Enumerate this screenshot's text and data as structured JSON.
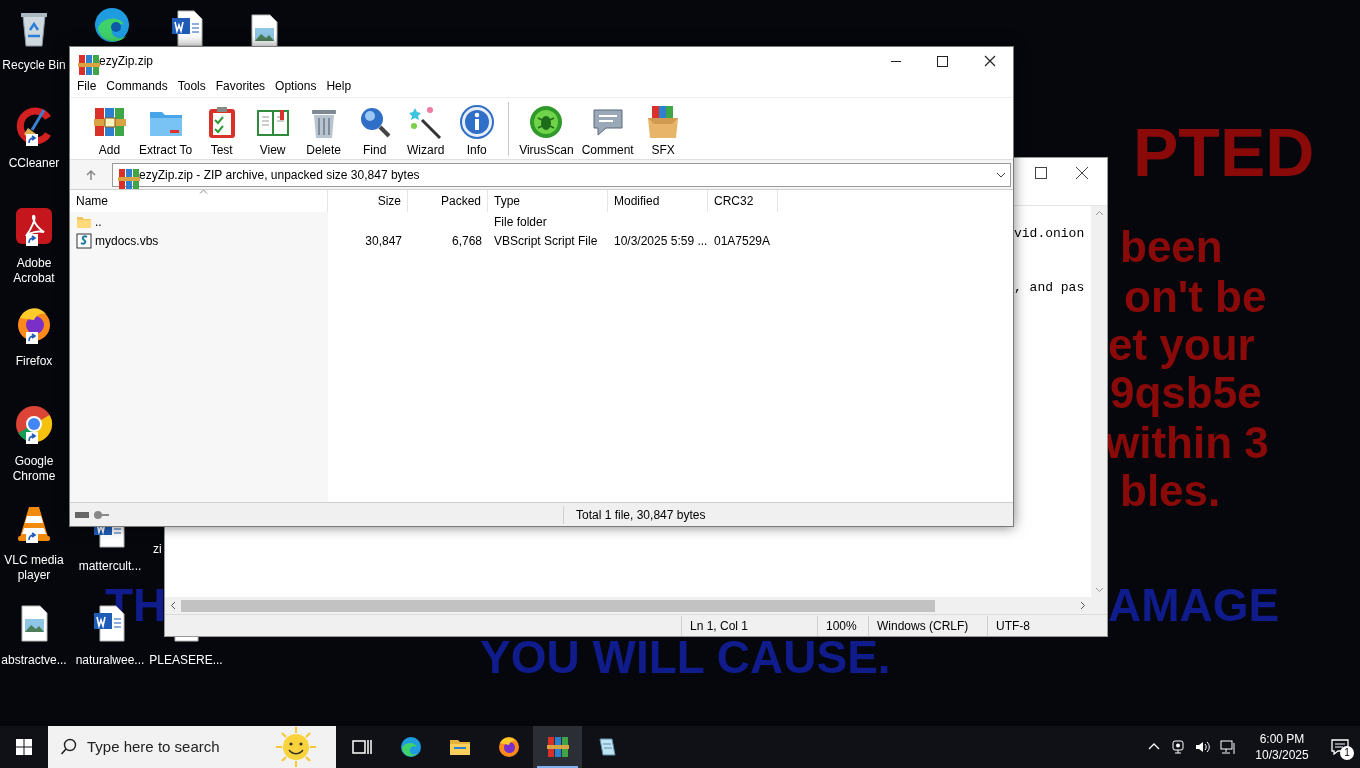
{
  "wallpaper_text": [
    {
      "text": "PTED",
      "color": "#8a0a0a"
    },
    {
      "text": "been",
      "color": "#8a0a0a"
    },
    {
      "text": "on't be",
      "color": "#8a0a0a"
    },
    {
      "text": "et your",
      "color": "#8a0a0a"
    },
    {
      "text": "9qsb5e",
      "color": "#8a0a0a"
    },
    {
      "text": "within 3",
      "color": "#8a0a0a"
    },
    {
      "text": "bles.",
      "color": "#8a0a0a"
    },
    {
      "text": "TH",
      "color": "#101c8c"
    },
    {
      "text": "AMAGE",
      "color": "#101c8c"
    },
    {
      "text": "YOU WILL CAUSE.",
      "color": "#101c8c"
    }
  ],
  "desktop_icons": [
    {
      "kind": "recycle",
      "label": "Recycle Bin"
    },
    {
      "kind": "edge"
    },
    {
      "kind": "word"
    },
    {
      "kind": "image"
    },
    {
      "kind": "ccleaner",
      "label": "CCleaner"
    },
    {
      "kind": "acrobat",
      "label": "Adobe Acrobat"
    },
    {
      "kind": "firefox",
      "label": "Firefox"
    },
    {
      "kind": "chrome",
      "label": "Google Chrome"
    },
    {
      "kind": "vlc",
      "label": "VLC media player"
    },
    {
      "kind": "word",
      "label": "mattercult..."
    },
    {
      "label": "zi"
    },
    {
      "kind": "image",
      "label": "abstractve..."
    },
    {
      "kind": "word",
      "label": "naturalwee..."
    },
    {
      "kind": "text",
      "label": "PLEASERE..."
    }
  ],
  "notepad": {
    "lines": [
      "vid.onion",
      ", and pas"
    ],
    "status": [
      "Ln 1, Col 1",
      "100%",
      "Windows (CRLF)",
      "UTF-8"
    ]
  },
  "winrar": {
    "title": "ezyZip.zip",
    "menu": [
      "File",
      "Commands",
      "Tools",
      "Favorites",
      "Options",
      "Help"
    ],
    "toolbar": [
      [
        {
          "kind": "add",
          "label": "Add"
        },
        {
          "kind": "extract",
          "label": "Extract To"
        },
        {
          "kind": "test",
          "label": "Test"
        },
        {
          "kind": "view",
          "label": "View"
        },
        {
          "kind": "delete",
          "label": "Delete"
        },
        {
          "kind": "find",
          "label": "Find"
        },
        {
          "kind": "wizard",
          "label": "Wizard"
        },
        {
          "kind": "info",
          "label": "Info"
        }
      ],
      [
        {
          "kind": "virus",
          "label": "VirusScan"
        },
        {
          "kind": "comment",
          "label": "Comment"
        },
        {
          "kind": "sfx",
          "label": "SFX"
        }
      ]
    ],
    "address": "ezyZip.zip - ZIP archive, unpacked size 30,847 bytes",
    "columns": [
      {
        "label": "Name",
        "sorted": true
      },
      {
        "label": "Size",
        "sorted": false
      },
      {
        "label": "Packed",
        "sorted": false
      },
      {
        "label": "Type",
        "sorted": false
      },
      {
        "label": "Modified",
        "sorted": false
      },
      {
        "label": "CRC32",
        "sorted": false
      }
    ],
    "rows": [
      {
        "kind": "folder",
        "name": "..",
        "type": "File folder"
      },
      {
        "kind": "script",
        "name": "mydocs.vbs",
        "size": "30,847",
        "packed": "6,768",
        "type": "VBScript Script File",
        "modified": "10/3/2025 5:59 ...",
        "crc32": "01A7529A"
      }
    ],
    "status": "Total 1 file, 30,847 bytes"
  },
  "taskbar": {
    "search_placeholder": "Type here to search",
    "apps": [
      {
        "kind": "taskview",
        "active": false
      },
      {
        "kind": "edge",
        "active": false
      },
      {
        "kind": "explorer",
        "active": false
      },
      {
        "kind": "firefox",
        "active": false
      },
      {
        "kind": "winrar",
        "active": true
      },
      {
        "kind": "notepad",
        "active": false
      }
    ],
    "time": "6:00 PM",
    "date": "10/3/2025",
    "notification_count": "1"
  }
}
